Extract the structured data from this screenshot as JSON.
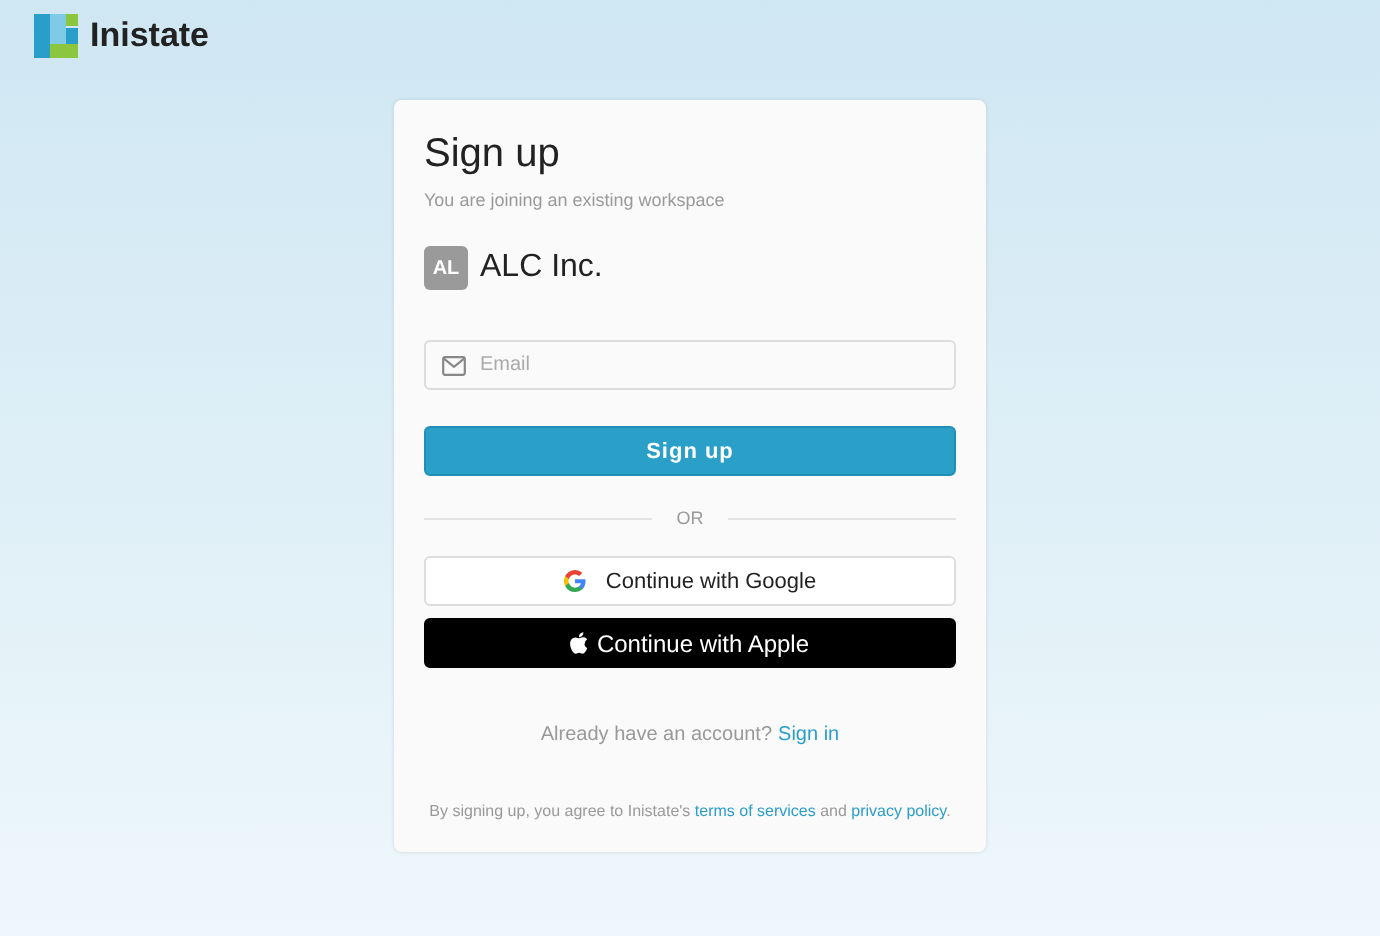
{
  "brand": {
    "name": "Inistate"
  },
  "card": {
    "title": "Sign up",
    "subtitle": "You are joining an existing workspace",
    "workspace": {
      "initials": "AL",
      "name": "ALC Inc."
    },
    "email": {
      "placeholder": "Email"
    },
    "submit": "Sign up",
    "divider": "OR",
    "providers": [
      {
        "kind": "google",
        "label": "Continue with Google"
      },
      {
        "kind": "apple",
        "label": "Continue with Apple"
      }
    ],
    "signin": {
      "text": "Already have an account?",
      "link": "Sign in"
    },
    "terms": {
      "before": "By signing up, you agree to Inistate's",
      "link1": "terms of services",
      "middle": "and",
      "link2": "privacy policy",
      "after": "."
    }
  }
}
